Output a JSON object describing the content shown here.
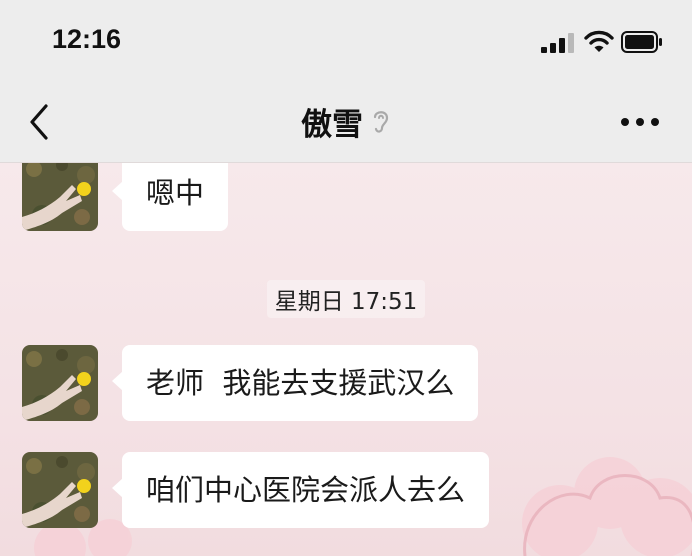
{
  "status_bar": {
    "time": "12:16",
    "signal_icon": "cellular-signal-icon",
    "wifi_icon": "wifi-icon",
    "battery_icon": "battery-icon"
  },
  "nav": {
    "back_icon": "chevron-left-icon",
    "title": "傲雪",
    "ear_icon": "ear-icon",
    "more_icon": "more-dots-icon"
  },
  "messages": [
    {
      "sender": "other",
      "text": "嗯中"
    },
    {
      "sender": "other",
      "text": "老师  我能去支援武汉么"
    },
    {
      "sender": "other",
      "text": "咱们中心医院会派人去么"
    }
  ],
  "timestamp": "星期日 17:51",
  "colors": {
    "header_bg": "#ededed",
    "chat_bg": "#f4e4e7",
    "bubble_bg": "#ffffff"
  }
}
